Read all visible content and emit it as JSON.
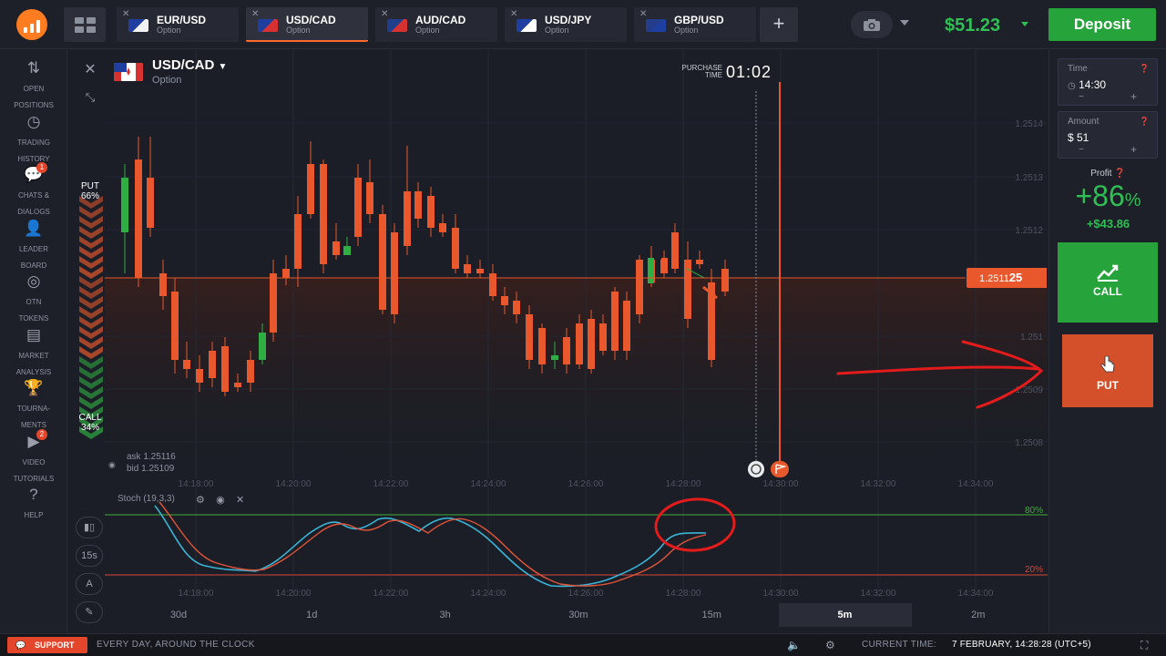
{
  "header": {
    "tabs": [
      {
        "name": "EUR/USD",
        "sub": "Option",
        "flag_a": "#1f3fa0",
        "flag_b": "#f2f2f2"
      },
      {
        "name": "USD/CAD",
        "sub": "Option",
        "flag_a": "#1f3fa0",
        "flag_b": "#d63232"
      },
      {
        "name": "AUD/CAD",
        "sub": "Option",
        "flag_a": "#1f3f8c",
        "flag_b": "#d63232"
      },
      {
        "name": "USD/JPY",
        "sub": "Option",
        "flag_a": "#1f3fa0",
        "flag_b": "#ffffff"
      },
      {
        "name": "GBP/USD",
        "sub": "Option",
        "flag_a": "#243d8a",
        "flag_b": "#1f3fa0"
      }
    ],
    "add_tab": "+",
    "balance": "$51.23",
    "deposit_label": "Deposit"
  },
  "sidebar": {
    "items": [
      {
        "label": "OPEN\nPOSITIONS",
        "icon": "sort-arrows-icon"
      },
      {
        "label": "TRADING\nHISTORY",
        "icon": "history-icon"
      },
      {
        "label": "CHATS &\nDIALOGS",
        "icon": "chat-icon",
        "badge": "1"
      },
      {
        "label": "LEADER\nBOARD",
        "icon": "leaderboard-icon"
      },
      {
        "label": "OTN\nTOKENS",
        "icon": "token-icon"
      },
      {
        "label": "MARKET\nANALYSIS",
        "icon": "news-icon"
      },
      {
        "label": "TOURNA-\nMENTS",
        "icon": "trophy-icon"
      },
      {
        "label": "VIDEO\nTUTORIALS",
        "icon": "play-icon",
        "badge": "2"
      },
      {
        "label": "HELP",
        "icon": "help-icon"
      }
    ]
  },
  "chart": {
    "asset_name": "USD/CAD",
    "asset_sub": "Option",
    "purchase_label_1": "PURCHASE",
    "purchase_label_2": "TIME",
    "purchase_time": "01:02",
    "put_label": "PUT",
    "put_pct": "66%",
    "call_label": "CALL",
    "call_pct": "34%",
    "ask": "ask 1.25116",
    "bid": "bid 1.25109",
    "current_price_main": "1.2511",
    "current_price_tail": "25",
    "price_ticks": [
      "1.2514",
      "1.2513",
      "1.2512",
      "1.251",
      "1.2509",
      "1.2508"
    ],
    "time_ticks": [
      "14:18:00",
      "14:20:00",
      "14:22:00",
      "14:24:00",
      "14:26:00",
      "14:28:00",
      "14:30:00",
      "14:32:00",
      "14:34:00"
    ],
    "stoch_label": "Stoch (19,3,3)",
    "stoch_hi": "80%",
    "stoch_lo": "20%",
    "colors": {
      "up": "#2fae43",
      "down": "#e8582c",
      "stoch_k": "#3ab4d6",
      "stoch_d": "#e0553a",
      "annotation": "#e31b1b"
    }
  },
  "indicator_buttons": [
    "15s",
    "A"
  ],
  "timeframes": [
    {
      "label": "30d",
      "active": false
    },
    {
      "label": "1d",
      "active": false
    },
    {
      "label": "3h",
      "active": false
    },
    {
      "label": "30m",
      "active": false
    },
    {
      "label": "15m",
      "active": false
    },
    {
      "label": "5m",
      "active": true
    },
    {
      "label": "2m",
      "active": false
    }
  ],
  "trade": {
    "time_label": "Time",
    "time_value": "14:30",
    "amount_label": "Amount",
    "amount_value": "$  51",
    "minus": "−",
    "plus": "+",
    "profit_label": "Profit",
    "profit_pct": "+86",
    "profit_pct_sign": "%",
    "profit_amount": "+$43.86",
    "call_label": "CALL",
    "put_label": "PUT"
  },
  "footer": {
    "support_label": "SUPPORT",
    "tagline": "EVERY DAY, AROUND THE CLOCK",
    "current_time_label": "CURRENT TIME:",
    "current_time_value": "7 FEBRUARY, 14:28:28 (UTC+5)"
  }
}
